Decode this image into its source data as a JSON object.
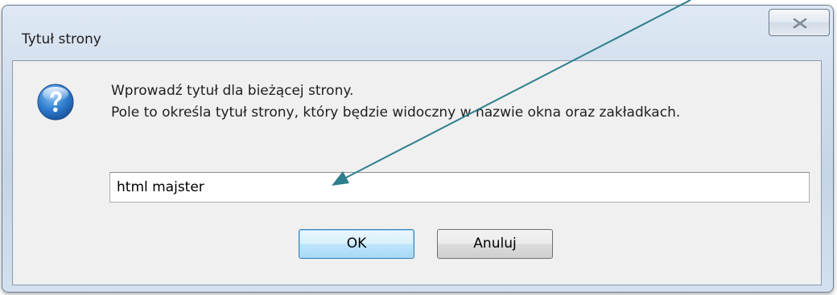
{
  "dialog": {
    "title": "Tytuł strony",
    "message_line1": "Wprowadź tytuł dla bieżącej strony.",
    "message_line2": "Pole to określa tytuł strony, który będzie widoczny w nazwie okna oraz zakładkach.",
    "input_value": "html majster",
    "ok_label": "OK",
    "cancel_label": "Anuluj",
    "icon": "question-icon",
    "close_icon": "close-icon"
  },
  "colors": {
    "annotation_arrow": "#2e7e8c",
    "question_icon_blue": "#2f7fd1",
    "default_button_border": "#3c7fb1"
  }
}
